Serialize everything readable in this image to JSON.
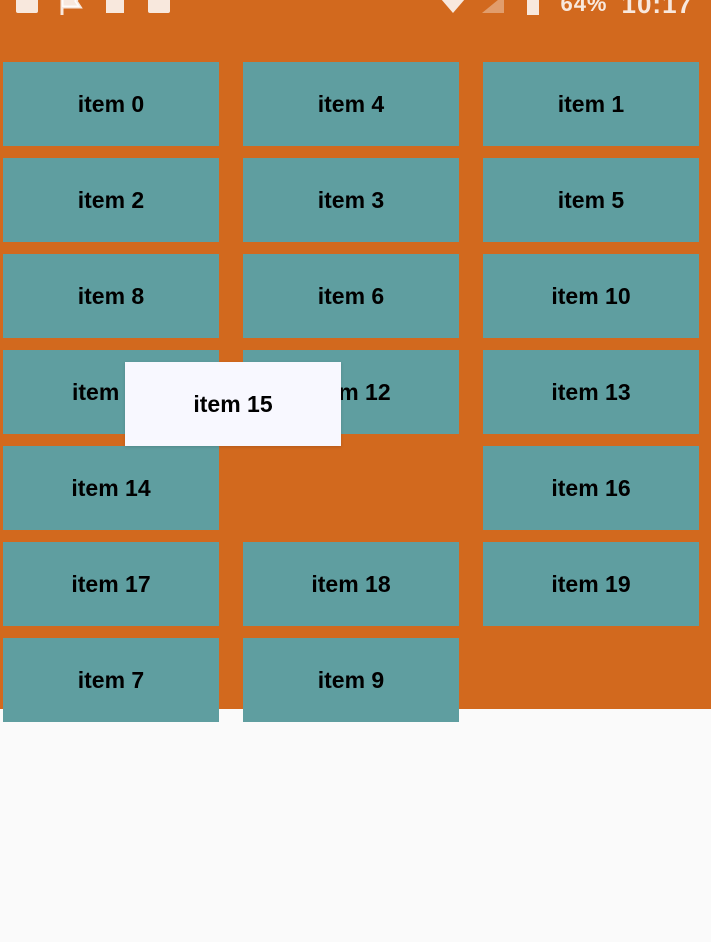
{
  "status_bar": {
    "battery": "64%",
    "time": "10:17",
    "icons_left": [
      "image-icon",
      "flag-icon",
      "calendar-icon",
      "edit-icon"
    ],
    "icons_right": [
      "wifi-icon",
      "signal-icon",
      "battery-icon"
    ]
  },
  "grid": {
    "items": [
      "item 0",
      "item 4",
      "item 1",
      "item 2",
      "item 3",
      "item 5",
      "item 8",
      "item 6",
      "item 10",
      "item 11",
      "item 12",
      "item 13",
      "item 14",
      "item 16",
      "item 17",
      "item 18",
      "item 19",
      "item 7",
      "item 9"
    ],
    "dragged_item": "item 15",
    "colors": {
      "background": "#D2691E",
      "tile": "#5F9EA0",
      "dragged_tile": "#F8F8FF",
      "page": "#FAFAFA"
    }
  }
}
